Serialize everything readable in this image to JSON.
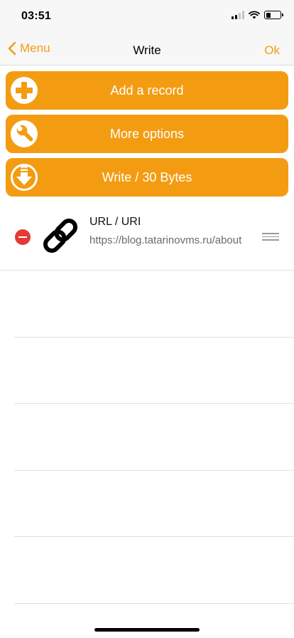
{
  "status_bar": {
    "time": "03:51",
    "icons": [
      "cellular-signal-icon",
      "wifi-icon",
      "battery-icon"
    ]
  },
  "nav": {
    "back_label": "Menu",
    "title": "Write",
    "ok_label": "Ok",
    "accent_color": "#f39c12"
  },
  "actions": {
    "add_record": {
      "label": "Add a record",
      "icon": "plus-circle-icon"
    },
    "more_options": {
      "label": "More options",
      "icon": "wrench-icon"
    },
    "write": {
      "label": "Write / 30 Bytes",
      "icon": "download-arrow-icon"
    }
  },
  "records": [
    {
      "type": "URL / URI",
      "value": "https://blog.tatarinovms.ru/about",
      "icon": "link-icon"
    }
  ],
  "colors": {
    "button_bg": "#f39c12",
    "delete": "#e53935"
  }
}
